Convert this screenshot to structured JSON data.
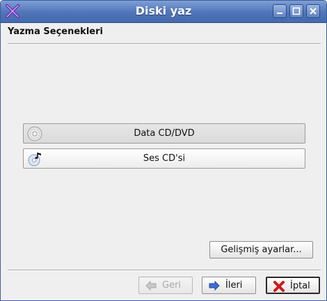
{
  "window": {
    "title": "Diski yaz"
  },
  "section": {
    "title": "Yazma Seçenekleri"
  },
  "options": [
    {
      "label": "Data CD/DVD",
      "icon": "cd-disc-icon"
    },
    {
      "label": "Ses CD'si",
      "icon": "audio-cd-icon"
    }
  ],
  "advanced": {
    "label": "Gelişmiş ayarlar..."
  },
  "nav": {
    "back_label": "Geri",
    "next_label": "İleri",
    "cancel_label": "İptal"
  },
  "colors": {
    "titlebar": "#5577bb",
    "cancel_icon": "#d01818"
  }
}
